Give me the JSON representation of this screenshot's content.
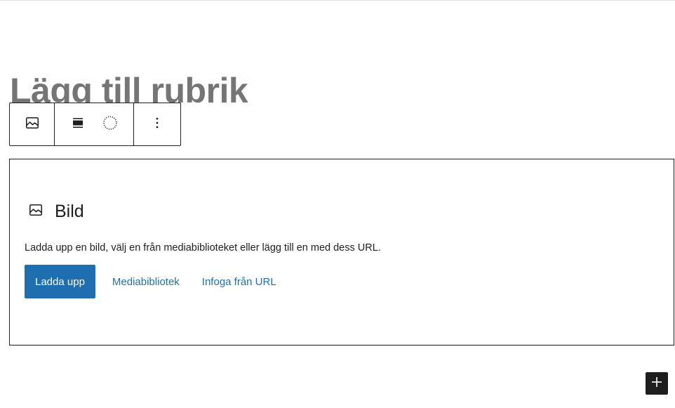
{
  "editor": {
    "title_placeholder": "Lägg till rubrik"
  },
  "block_toolbar": {
    "items": [
      {
        "icon": "image-icon",
        "label": "Bild"
      },
      {
        "icon": "align-center-icon"
      },
      {
        "icon": "duotone-circle-icon"
      },
      {
        "icon": "more-options-icon"
      }
    ]
  },
  "image_block": {
    "title": "Bild",
    "instructions": "Ladda upp en bild, välj en från mediabiblioteket eller lägg till en med dess URL.",
    "upload_label": "Ladda upp",
    "media_library_label": "Mediabibliotek",
    "insert_url_label": "Infoga från URL"
  },
  "colors": {
    "primary": "#1f6fb0",
    "dark": "#1e1e1e",
    "title_gray": "#757575"
  },
  "inserter": {
    "icon": "plus-icon"
  }
}
